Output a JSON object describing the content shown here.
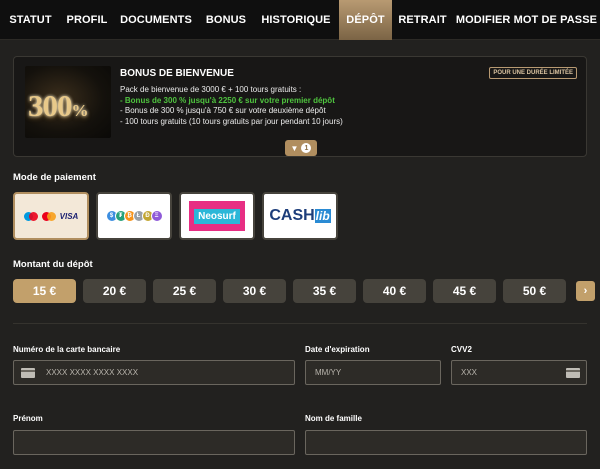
{
  "tabs": [
    {
      "label": "STATUT",
      "active": false
    },
    {
      "label": "PROFIL",
      "active": false
    },
    {
      "label": "DOCUMENTS",
      "active": false
    },
    {
      "label": "BONUS",
      "active": false
    },
    {
      "label": "HISTORIQUE",
      "active": false
    },
    {
      "label": "DÉPÔT",
      "active": true
    },
    {
      "label": "RETRAIT",
      "active": false
    },
    {
      "label": "MODIFIER MOT DE PASSE",
      "active": false
    }
  ],
  "bonus": {
    "image_main": "300",
    "image_pct": "%",
    "title": "BONUS DE BIENVENUE",
    "badge": "POUR UNE DURÉE LIMITÉE",
    "line1": "Pack de bienvenue de 3000 € + 100 tours gratuits :",
    "line2": "- Bonus de 300 % jusqu'à 2250 € sur votre premier dépôt",
    "line3": "- Bonus de 300 % jusqu'à 750 € sur votre deuxième dépôt",
    "line4": "- 100 tours gratuits (10 tours gratuits par jour pendant 10 jours)",
    "expand_count": "1",
    "highlight_color": "#4fc33f"
  },
  "payment": {
    "label": "Mode de paiement",
    "selected": "cards",
    "visa": "VISA",
    "neosurf": "Neosurf",
    "cashlib_a": "CASH",
    "cashlib_b": "lib",
    "crypto_glyphs": [
      "$",
      "₮",
      "₿",
      "Ł",
      "Ð",
      "Ξ"
    ]
  },
  "amounts": {
    "label": "Montant du dépôt",
    "items": [
      "15 €",
      "20 €",
      "25 €",
      "30 €",
      "35 €",
      "40 €",
      "45 €",
      "50 €"
    ],
    "selected_index": 0,
    "next_icon": "›"
  },
  "form": {
    "card_number_label": "Numéro de la carte bancaire",
    "card_number_placeholder": "XXXX XXXX XXXX XXXX",
    "expiry_label": "Date d'expiration",
    "expiry_placeholder": "MM/YY",
    "cvv_label": "CVV2",
    "cvv_placeholder": "XXX",
    "first_name_label": "Prénom",
    "first_name_value": "",
    "last_name_label": "Nom de famille",
    "last_name_value": ""
  },
  "colors": {
    "accent": "#c2a06b",
    "background": "#22211f",
    "tabbar": "#0f0f0f"
  }
}
